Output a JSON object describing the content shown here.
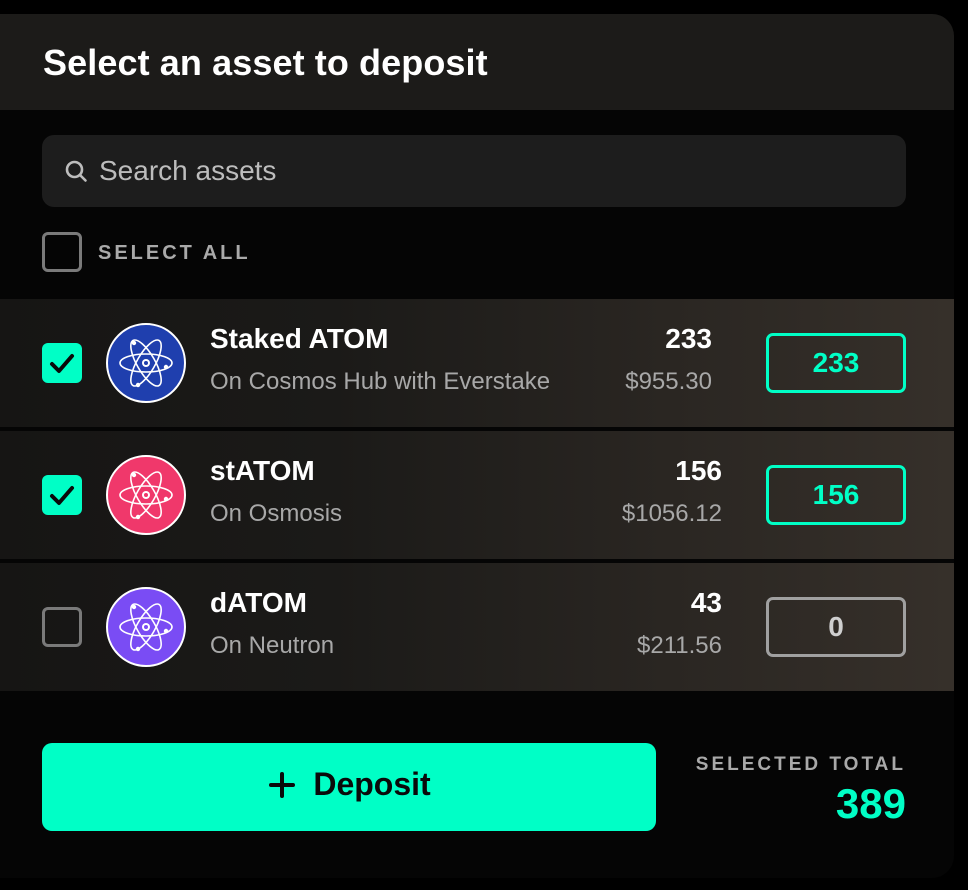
{
  "modal": {
    "title": "Select an asset to deposit"
  },
  "search": {
    "placeholder": "Search assets",
    "value": "",
    "icon": "search-icon"
  },
  "select_all": {
    "label": "SELECT ALL",
    "checked": false
  },
  "assets": [
    {
      "name": "Staked ATOM",
      "network": "On Cosmos Hub with Everstake",
      "amount": "233",
      "usd_value": "$955.30",
      "input_value": "233",
      "checked": true,
      "icon": "atom-icon",
      "icon_color": "#1f3fae"
    },
    {
      "name": "stATOM",
      "network": "On Osmosis",
      "amount": "156",
      "usd_value": "$1056.12",
      "input_value": "156",
      "checked": true,
      "icon": "atom-icon",
      "icon_color": "#f0386b"
    },
    {
      "name": "dATOM",
      "network": "On Neutron",
      "amount": "43",
      "usd_value": "$211.56",
      "input_value": "0",
      "checked": false,
      "icon": "atom-icon",
      "icon_color": "#7a4cf4"
    }
  ],
  "footer": {
    "deposit_label": "Deposit",
    "deposit_icon": "plus-icon",
    "total_label": "SELECTED TOTAL",
    "total_value": "389"
  },
  "colors": {
    "accent": "#00ffc6",
    "background": "#050505",
    "header_bg": "#1c1b19"
  }
}
